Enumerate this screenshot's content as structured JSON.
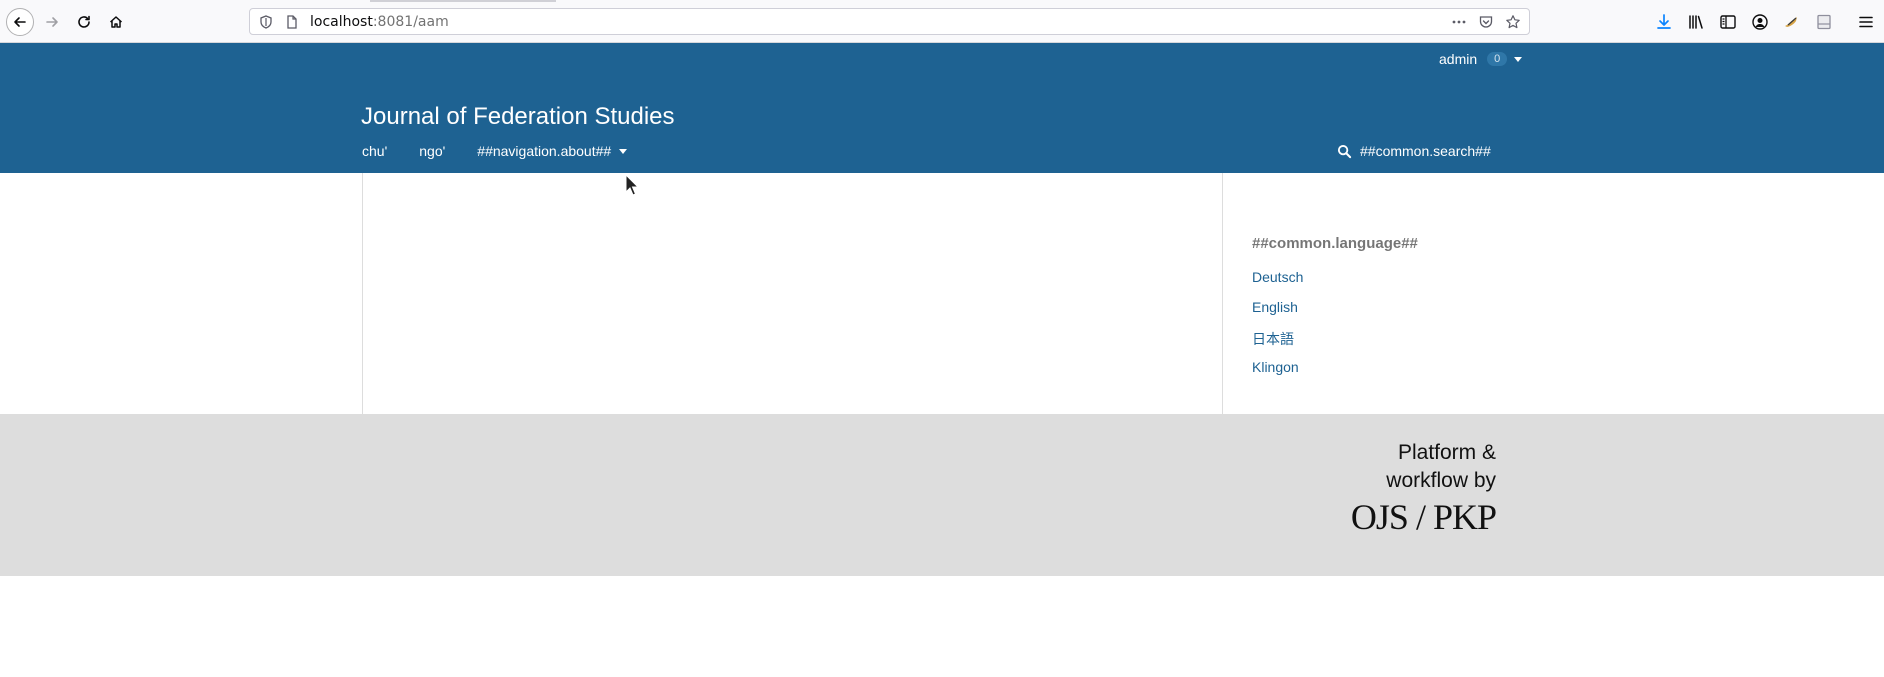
{
  "browser": {
    "url_host": "localhost",
    "url_path": ":8081/aam"
  },
  "header": {
    "user_name": "admin",
    "notification_count": "0",
    "journal_title": "Journal of Federation Studies",
    "nav": [
      {
        "label": "chu'"
      },
      {
        "label": "ngo'"
      },
      {
        "label": "##navigation.about##"
      }
    ],
    "search_label": "##common.search##"
  },
  "sidebar": {
    "title": "##common.language##",
    "languages": [
      "Deutsch",
      "English",
      "日本語",
      "Klingon"
    ]
  },
  "footer": {
    "brand_line1": "Platform &",
    "brand_line2": "workflow by",
    "brand_logo": "OJS / PKP"
  },
  "colors": {
    "header_bg": "#1e6292",
    "link": "#1e6292",
    "footer_bg": "#dddddd"
  }
}
